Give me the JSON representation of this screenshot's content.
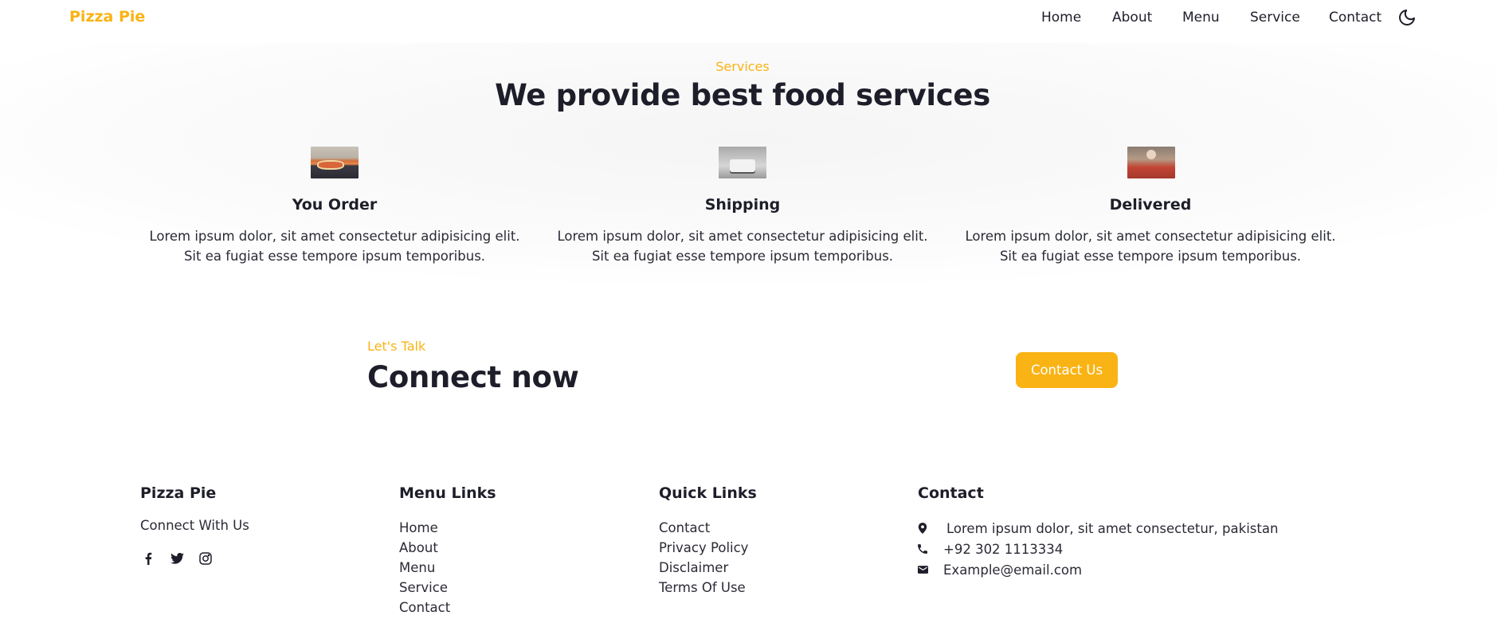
{
  "header": {
    "logo": "Pizza Pie",
    "nav": [
      "Home",
      "About",
      "Menu",
      "Service",
      "Contact"
    ],
    "theme_icon": "moon-icon"
  },
  "services": {
    "eyebrow": "Services",
    "title": "We provide best food services",
    "cards": [
      {
        "title": "You Order",
        "text": "Lorem ipsum dolor, sit amet consectetur adipisicing elit. Sit ea fugiat esse tempore ipsum temporibus.",
        "image": "pizza-box-image"
      },
      {
        "title": "Shipping",
        "text": "Lorem ipsum dolor, sit amet consectetur adipisicing elit. Sit ea fugiat esse tempore ipsum temporibus.",
        "image": "delivery-van-image"
      },
      {
        "title": "Delivered",
        "text": "Lorem ipsum dolor, sit amet consectetur adipisicing elit. Sit ea fugiat esse tempore ipsum temporibus.",
        "image": "courier-image"
      }
    ]
  },
  "connect": {
    "eyebrow": "Let's Talk",
    "title": "Connect now",
    "button": "Contact Us"
  },
  "footer": {
    "brand": {
      "title": "Pizza Pie",
      "subtitle": "Connect With Us",
      "socials": [
        "facebook-icon",
        "twitter-icon",
        "instagram-icon"
      ]
    },
    "menu_links": {
      "title": "Menu Links",
      "items": [
        "Home",
        "About",
        "Menu",
        "Service",
        "Contact"
      ]
    },
    "quick_links": {
      "title": "Quick Links",
      "items": [
        "Contact",
        "Privacy Policy",
        "Disclaimer",
        "Terms Of Use"
      ]
    },
    "contact": {
      "title": "Contact",
      "address": "Lorem ipsum dolor, sit amet consectetur, pakistan",
      "phone": "+92 302 1113334",
      "email": "Example@email.com"
    }
  },
  "colors": {
    "accent": "#f9b314",
    "text": "#1e1e2a"
  }
}
